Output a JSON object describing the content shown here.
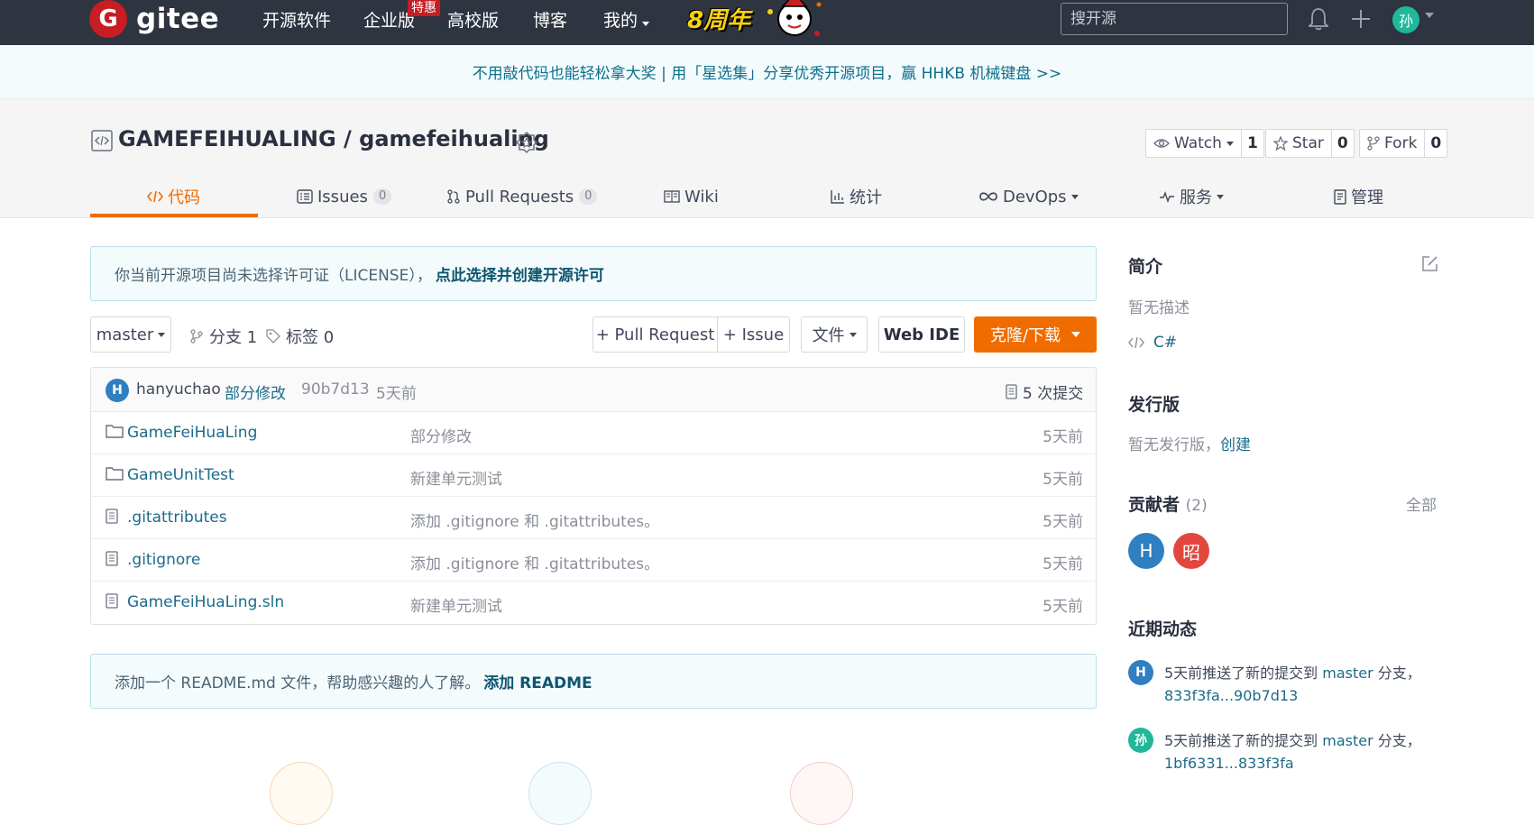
{
  "nav": {
    "logo_letter": "G",
    "logo_text": "gitee",
    "items": [
      "开源软件",
      "企业版",
      "高校版",
      "博客",
      "我的"
    ],
    "enterprise_tag": "特惠",
    "anniversary": "8周年",
    "search_placeholder": "搜开源",
    "user_initial": "孙"
  },
  "banner": {
    "text": "不用敲代码也能轻松拿大奖 | 用「星选集」分享优秀开源项目，赢 HHKB 机械键盘 >>"
  },
  "repo": {
    "title": "GAMEFEIHUALING / gamefeihualing",
    "watch": {
      "label": "Watch",
      "count": "1"
    },
    "star": {
      "label": "Star",
      "count": "0"
    },
    "fork": {
      "label": "Fork",
      "count": "0"
    }
  },
  "tabs": [
    {
      "label": "代码",
      "icon": "code-icon"
    },
    {
      "label": "Issues",
      "count": "0",
      "icon": "issues-icon"
    },
    {
      "label": "Pull Requests",
      "count": "0",
      "icon": "pull-request-icon"
    },
    {
      "label": "Wiki",
      "icon": "wiki-icon"
    },
    {
      "label": "统计",
      "icon": "chart-icon"
    },
    {
      "label": "DevOps",
      "icon": "infinity-icon"
    },
    {
      "label": "服务",
      "icon": "pulse-icon"
    },
    {
      "label": "管理",
      "icon": "manage-icon"
    }
  ],
  "license_notice": {
    "text": "你当前开源项目尚未选择许可证（LICENSE），",
    "link": "点此选择并创建开源许可"
  },
  "toolbar": {
    "branch": "master",
    "branches": "分支 1",
    "tags": "标签 0",
    "pull_request": "+ Pull Request",
    "issue": "+ Issue",
    "files": "文件",
    "web_ide": "Web IDE",
    "clone": "克隆/下载"
  },
  "last_commit": {
    "avatar": "H",
    "author": "hanyuchao",
    "message": "部分修改",
    "hash": "90b7d13",
    "time": "5天前",
    "commits": "5 次提交"
  },
  "files": [
    {
      "type": "folder",
      "name": "GameFeiHuaLing",
      "message": "部分修改",
      "time": "5天前"
    },
    {
      "type": "folder",
      "name": "GameUnitTest",
      "message": "新建单元测试",
      "time": "5天前"
    },
    {
      "type": "file",
      "name": ".gitattributes",
      "message": "添加 .gitignore 和 .gitattributes。",
      "time": "5天前"
    },
    {
      "type": "file",
      "name": ".gitignore",
      "message": "添加 .gitignore 和 .gitattributes。",
      "time": "5天前"
    },
    {
      "type": "file",
      "name": "GameFeiHuaLing.sln",
      "message": "新建单元测试",
      "time": "5天前"
    }
  ],
  "readme_notice": {
    "text": "添加一个 README.md 文件，帮助感兴趣的人了解。",
    "link": "添加 README"
  },
  "sidebar": {
    "intro_title": "简介",
    "intro_text": "暂无描述",
    "language": "C#",
    "release_title": "发行版",
    "release_text": "暂无发行版，",
    "release_link": "创建",
    "contributors_title": "贡献者",
    "contributors_count": "(2)",
    "contributors_all": "全部",
    "contributors": [
      {
        "initial": "H",
        "color": "#2f7fc1"
      },
      {
        "initial": "昭",
        "color": "#e2463c"
      }
    ],
    "activity_title": "近期动态",
    "activities": [
      {
        "avatar": "H",
        "color": "#2f7fc1",
        "prefix": "5天前推送了新的提交到",
        "branch": "master",
        "mid": "分支，",
        "range": "833f3fa...90b7d13"
      },
      {
        "avatar": "孙",
        "color": "#1fb89a",
        "prefix": "5天前推送了新的提交到",
        "branch": "master",
        "mid": "分支，",
        "range": "1bf6331...833f3fa"
      }
    ]
  }
}
